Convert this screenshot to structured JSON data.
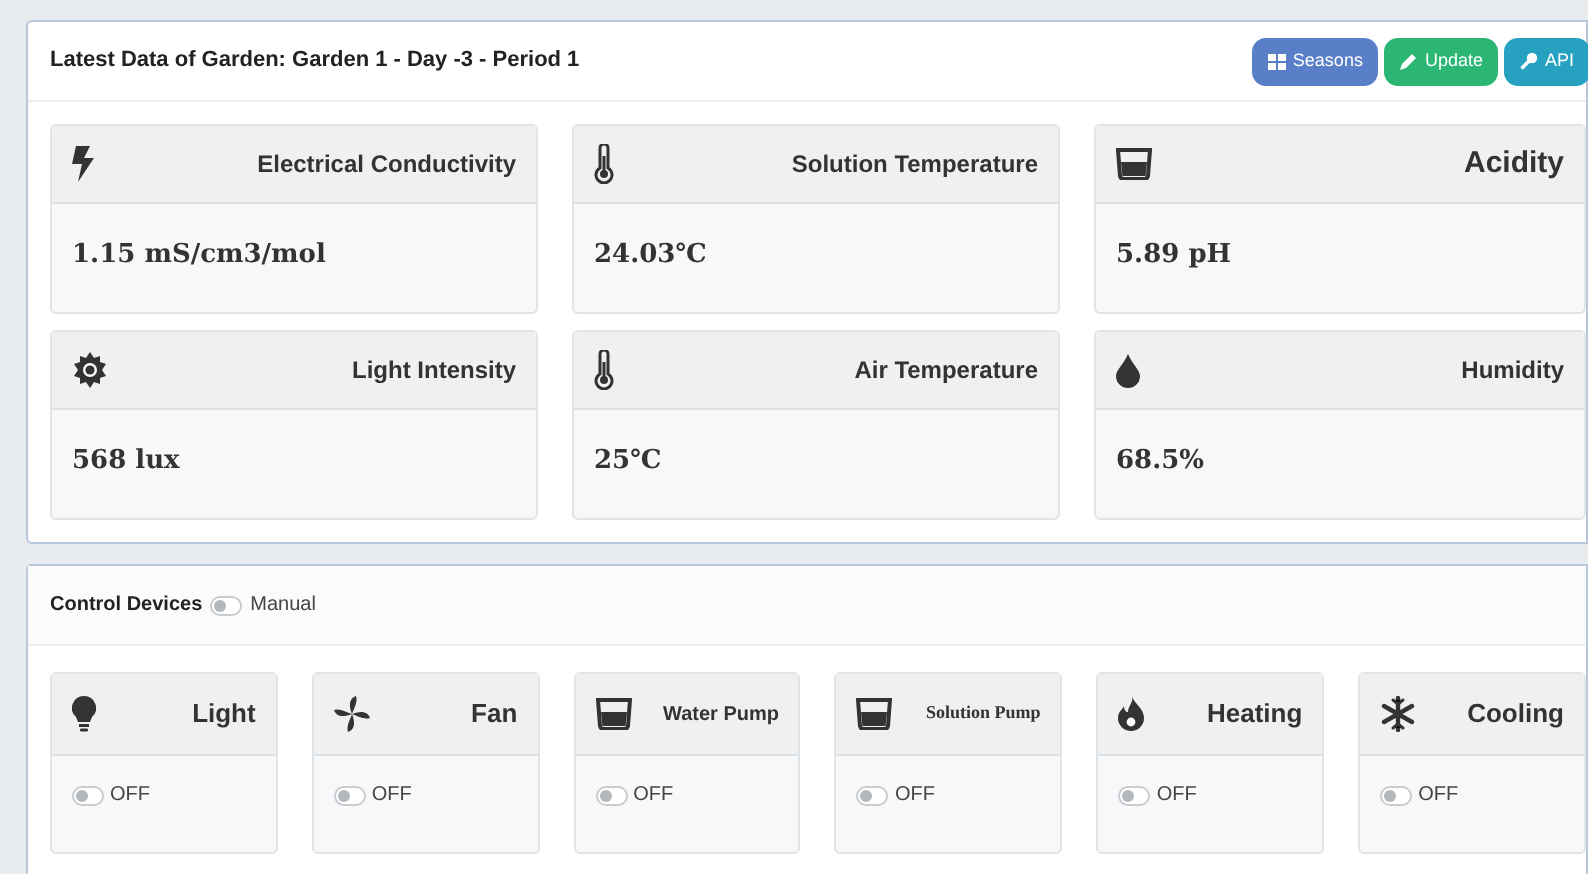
{
  "garden_panel": {
    "title": "Latest Data of Garden: Garden 1 - Day -3 - Period 1",
    "buttons": [
      {
        "label": "Seasons",
        "kind": "seasons"
      },
      {
        "label": "Update",
        "kind": "update"
      },
      {
        "label": "API",
        "kind": "api"
      }
    ],
    "sensors": [
      {
        "label": "Electrical Conductivity",
        "value": "1.15 mS/cm3/mol"
      },
      {
        "label": "Solution Temperature",
        "value": "24.03℃"
      },
      {
        "label": "Acidity",
        "value": "5.89 pH"
      },
      {
        "label": "Light Intensity",
        "value": "568 lux"
      },
      {
        "label": "Air Temperature",
        "value": "25℃"
      },
      {
        "label": "Humidity",
        "value": "68.5%"
      }
    ]
  },
  "control_panel": {
    "title": "Control Devices",
    "manual": {
      "label": "Manual",
      "on": false
    },
    "devices": [
      {
        "label": "Light",
        "state": "OFF",
        "on": false
      },
      {
        "label": "Fan",
        "state": "OFF",
        "on": false
      },
      {
        "label": "Water Pump",
        "state": "OFF",
        "on": false
      },
      {
        "label": "Solution Pump",
        "state": "OFF",
        "on": false
      },
      {
        "label": "Heating",
        "state": "OFF",
        "on": false
      },
      {
        "label": "Cooling",
        "state": "OFF",
        "on": false
      }
    ]
  }
}
